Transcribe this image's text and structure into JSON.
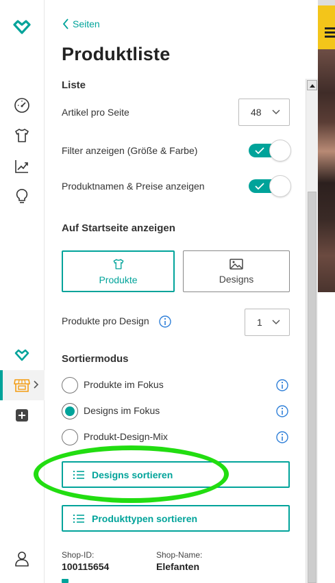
{
  "nav": {
    "back_label": "Seiten"
  },
  "page": {
    "title": "Produktliste"
  },
  "list_section": {
    "heading": "Liste",
    "items_per_page_label": "Artikel pro Seite",
    "items_per_page_value": "48",
    "show_filter_label": "Filter anzeigen (Größe & Farbe)",
    "show_filter_on": true,
    "show_names_prices_label": "Produktnamen & Preise anzeigen",
    "show_names_prices_on": true
  },
  "home_section": {
    "heading": "Auf Startseite anzeigen",
    "products_button": "Produkte",
    "designs_button": "Designs",
    "selected": "Produkte",
    "products_per_design_label": "Produkte pro Design",
    "products_per_design_value": "1"
  },
  "sort_section": {
    "heading": "Sortiermodus",
    "options": [
      {
        "label": "Produkte im Fokus",
        "selected": false
      },
      {
        "label": "Designs im Fokus",
        "selected": true
      },
      {
        "label": "Produkt-Design-Mix",
        "selected": false
      }
    ],
    "sort_designs_button": "Designs sortieren",
    "sort_product_types_button": "Produkttypen sortieren"
  },
  "shop": {
    "id_label": "Shop-ID:",
    "id_value": "100115654",
    "name_label": "Shop-Name:",
    "name_value": "Elefanten"
  },
  "colors": {
    "accent": "#00a39a",
    "highlight": "#22dd11",
    "banner": "#f3c51a"
  },
  "icons": {
    "rail": [
      "logo-heart-icon",
      "dashboard-gauge-icon",
      "tshirt-icon",
      "chart-growth-icon",
      "lightbulb-icon",
      "logo-small-icon",
      "shop-store-icon",
      "add-square-icon",
      "user-icon"
    ]
  }
}
